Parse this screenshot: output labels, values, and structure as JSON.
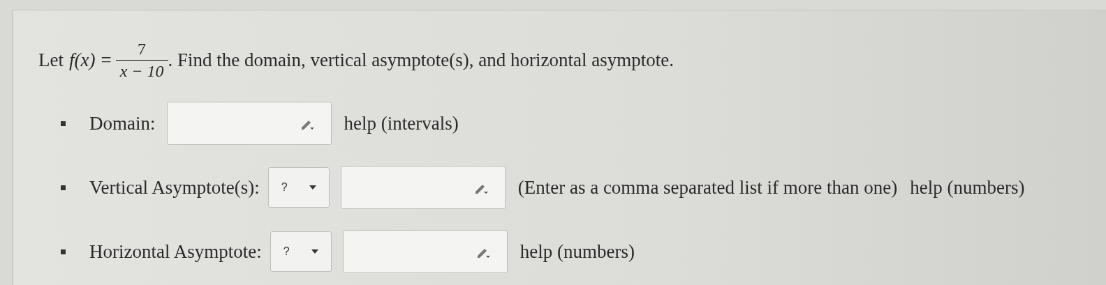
{
  "question": {
    "prefix": "Let",
    "function": "f(x)",
    "equals": "=",
    "numerator": "7",
    "denominator": "x − 10",
    "suffix": ". Find the domain, vertical asymptote(s), and horizontal asymptote."
  },
  "answers": [
    {
      "kind": "field",
      "label": "Domain:",
      "help": "help (intervals)"
    },
    {
      "kind": "dropdown-field",
      "label": "Vertical Asymptote(s):",
      "dropdown": "?",
      "note": "(Enter as a comma separated list if more than one)",
      "help": "help (numbers)"
    },
    {
      "kind": "dropdown-field",
      "label": "Horizontal Asymptote:",
      "dropdown": "?",
      "help": "help (numbers)"
    }
  ]
}
